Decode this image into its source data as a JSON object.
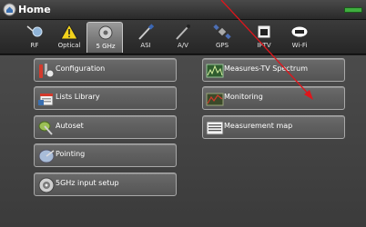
{
  "window": {
    "title": "Home"
  },
  "tabs": [
    {
      "label": "RF",
      "icon": "rf-icon"
    },
    {
      "label": "Optical",
      "icon": "warning-triangle-icon"
    },
    {
      "label": "5 GHz",
      "icon": "satellite-dish-icon",
      "active": true
    },
    {
      "label": "ASI",
      "icon": "asi-cable-icon"
    },
    {
      "label": "A/V",
      "icon": "av-cable-icon"
    },
    {
      "label": "GPS",
      "icon": "gps-satellite-icon"
    },
    {
      "label": "IPTV",
      "icon": "network-port-icon"
    },
    {
      "label": "Wi-Fi",
      "icon": "wifi-icon"
    }
  ],
  "menu": {
    "left": [
      {
        "label": "Configuration",
        "icon": "configuration-icon"
      },
      {
        "label": "Lists Library",
        "icon": "lists-library-icon"
      },
      {
        "label": "Autoset",
        "icon": "autoset-icon"
      },
      {
        "label": "Pointing",
        "icon": "pointing-icon"
      },
      {
        "label": "5GHz input setup",
        "icon": "input-setup-icon"
      }
    ],
    "right": [
      {
        "label": "Measures-TV Spectrum",
        "icon": "spectrum-icon"
      },
      {
        "label": "Monitoring",
        "icon": "monitoring-icon"
      },
      {
        "label": "Measurement map",
        "icon": "measurement-map-icon"
      }
    ]
  },
  "colors": {
    "annotation": "#e0151b",
    "battery": "#3fae3f",
    "warning": "#f2d21b"
  }
}
